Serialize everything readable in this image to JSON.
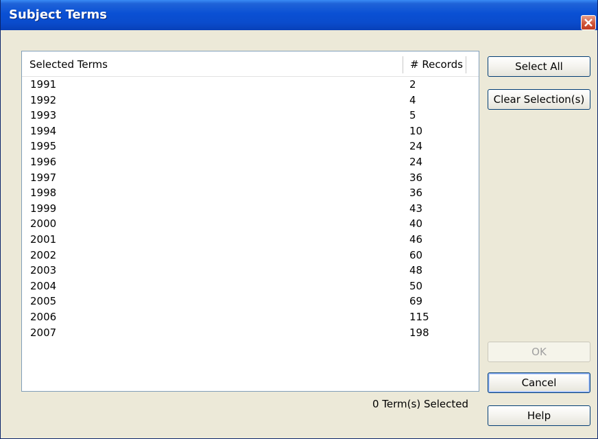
{
  "window": {
    "title": "Subject Terms"
  },
  "table": {
    "columns": {
      "term": "Selected Terms",
      "records": "# Records"
    },
    "rows": [
      {
        "term": "1991",
        "records": "2"
      },
      {
        "term": "1992",
        "records": "4"
      },
      {
        "term": "1993",
        "records": "5"
      },
      {
        "term": "1994",
        "records": "10"
      },
      {
        "term": "1995",
        "records": "24"
      },
      {
        "term": "1996",
        "records": "24"
      },
      {
        "term": "1997",
        "records": "36"
      },
      {
        "term": "1998",
        "records": "36"
      },
      {
        "term": "1999",
        "records": "43"
      },
      {
        "term": "2000",
        "records": "40"
      },
      {
        "term": "2001",
        "records": "46"
      },
      {
        "term": "2002",
        "records": "60"
      },
      {
        "term": "2003",
        "records": "48"
      },
      {
        "term": "2004",
        "records": "50"
      },
      {
        "term": "2005",
        "records": "69"
      },
      {
        "term": "2006",
        "records": "115"
      },
      {
        "term": "2007",
        "records": "198"
      }
    ]
  },
  "buttons": {
    "select_all": "Select All",
    "clear_selection": "Clear Selection(s)",
    "ok": "OK",
    "cancel": "Cancel",
    "help": "Help"
  },
  "status": {
    "selected": "0 Term(s) Selected"
  },
  "colors": {
    "title_bar": "#0a50d4",
    "close_button": "#d0563a",
    "dialog_bg": "#ece9d8"
  }
}
